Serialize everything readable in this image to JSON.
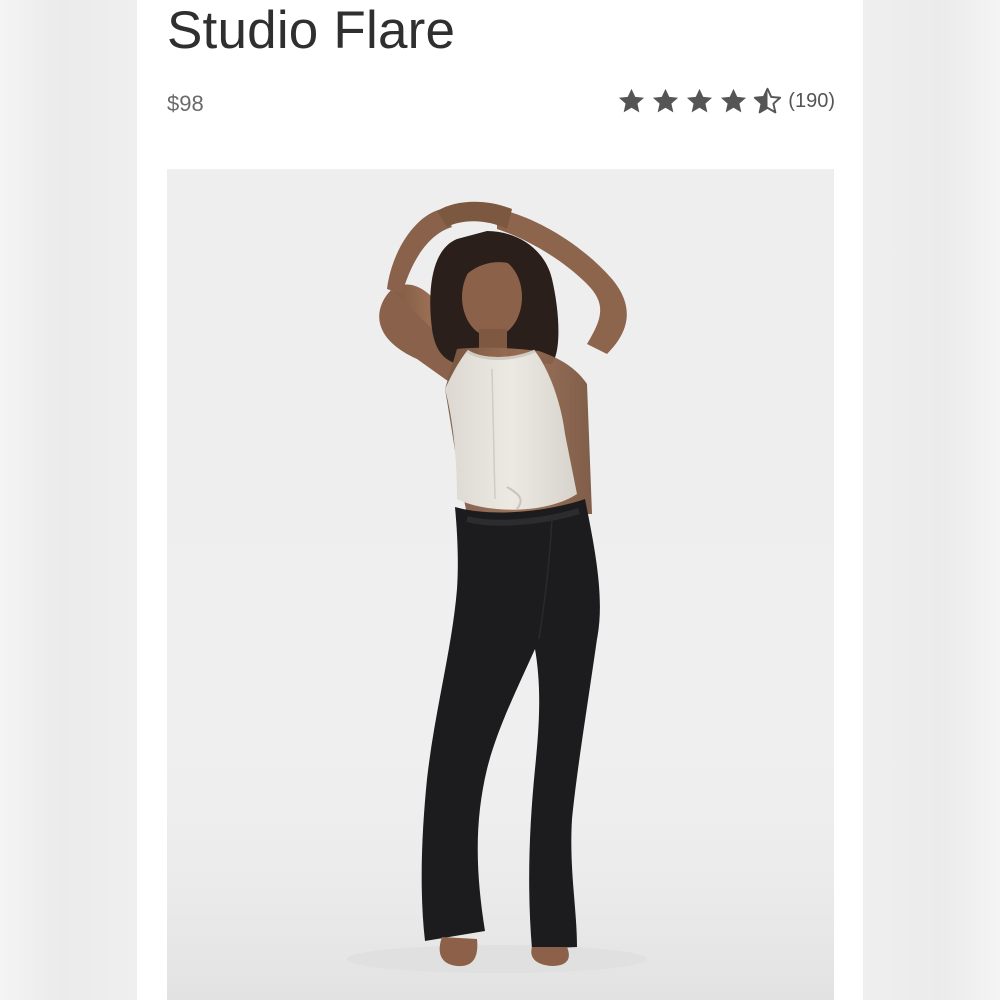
{
  "product": {
    "title": "Studio Flare",
    "price": "$98",
    "rating": {
      "stars": 4.5,
      "max": 5,
      "review_count": "(190)"
    },
    "image": {
      "subject": "model-in-white-tank-and-black-flare-leggings"
    }
  },
  "colors": {
    "title_text": "#2f2f2f",
    "price_text": "#6a6a6a",
    "star": "#555555",
    "photo_background": "#eeeeef",
    "pants": "#1c1c1e",
    "top": "#e7e4de"
  },
  "icons": {
    "star": "star-icon",
    "half_star": "star-half-icon"
  }
}
